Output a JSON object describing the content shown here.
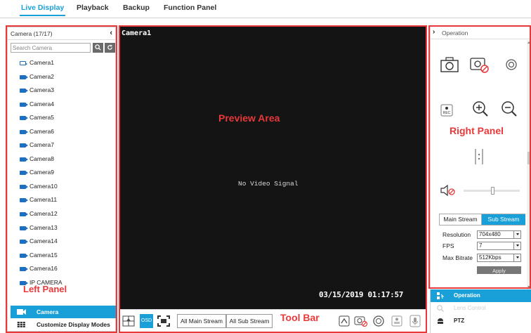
{
  "tabs": [
    {
      "label": "Live Display",
      "active": true
    },
    {
      "label": "Playback",
      "active": false
    },
    {
      "label": "Backup",
      "active": false
    },
    {
      "label": "Function Panel",
      "active": false
    }
  ],
  "left_panel": {
    "title": "Camera (17/17)",
    "collapse_icon": "chevron-left-icon",
    "search_placeholder": "Search Camera",
    "cameras": [
      "Camera1",
      "Camera2",
      "Camera3",
      "Camera4",
      "Camera5",
      "Camera6",
      "Camera7",
      "Camera8",
      "Camera9",
      "Camera10",
      "Camera11",
      "Camera12",
      "Camera13",
      "Camera14",
      "Camera15",
      "Camera16",
      "IP CAMERA"
    ],
    "bottom_items": [
      {
        "label": "Camera",
        "icon": "camera-icon",
        "active": true
      },
      {
        "label": "Customize Display Modes",
        "icon": "grid-icon",
        "active": false
      }
    ]
  },
  "preview": {
    "camera_name": "Camera1",
    "no_signal": "No Video Signal",
    "timestamp": "03/15/2019 01:17:57"
  },
  "toolbar": {
    "osd_label": "OSD",
    "all_main_stream": "All Main Stream",
    "all_sub_stream": "All Sub Stream"
  },
  "right_panel": {
    "title": "Operation",
    "stream_tabs": {
      "main": "Main Stream",
      "sub": "Sub Stream",
      "active": "sub"
    },
    "resolution_label": "Resolution",
    "resolution_value": "704x480",
    "fps_label": "FPS",
    "fps_value": "7",
    "max_bitrate_label": "Max Bitrate",
    "max_bitrate_value": "512Kbps",
    "apply_label": "Apply",
    "bottom_items": [
      {
        "label": "Operation",
        "icon": "operation-icon",
        "state": "active"
      },
      {
        "label": "Lens Control",
        "icon": "lens-icon",
        "state": "disabled"
      },
      {
        "label": "PTZ",
        "icon": "ptz-icon",
        "state": "normal"
      }
    ]
  },
  "annotations": {
    "left": "Left Panel",
    "preview": "Preview Area",
    "right": "Right Panel",
    "toolbar": "Tool Bar"
  },
  "colors": {
    "accent": "#1aa0d8",
    "annotation": "#e8383a",
    "preview_bg": "#141414",
    "camera_icon": "#1e6fbf"
  }
}
